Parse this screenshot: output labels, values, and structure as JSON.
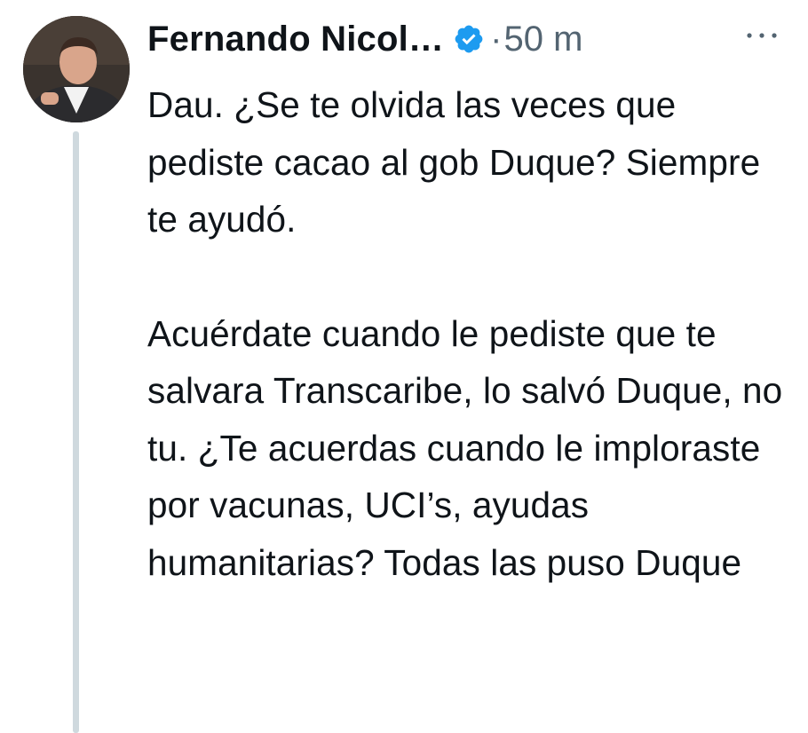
{
  "tweet": {
    "author_name": "Fernando Nicol…",
    "verified_icon": "verified-badge-icon",
    "separator": "·",
    "time": "50 m",
    "more_icon": "more-options-icon",
    "paragraphs": [
      "Dau. ¿Se te olvida las veces que pediste cacao al gob Duque? Siempre te ayudó.",
      "Acuérdate cuando le pediste que te salvara Transcaribe, lo salvó Duque, no tu. ¿Te acuerdas cuando le imploraste por vacunas, UCI’s, ayudas humanitarias? Todas las puso Duque"
    ]
  },
  "colors": {
    "text": "#0f1419",
    "secondary": "#536471",
    "verified": "#1d9bf0",
    "thread_line": "#cfd9de"
  }
}
